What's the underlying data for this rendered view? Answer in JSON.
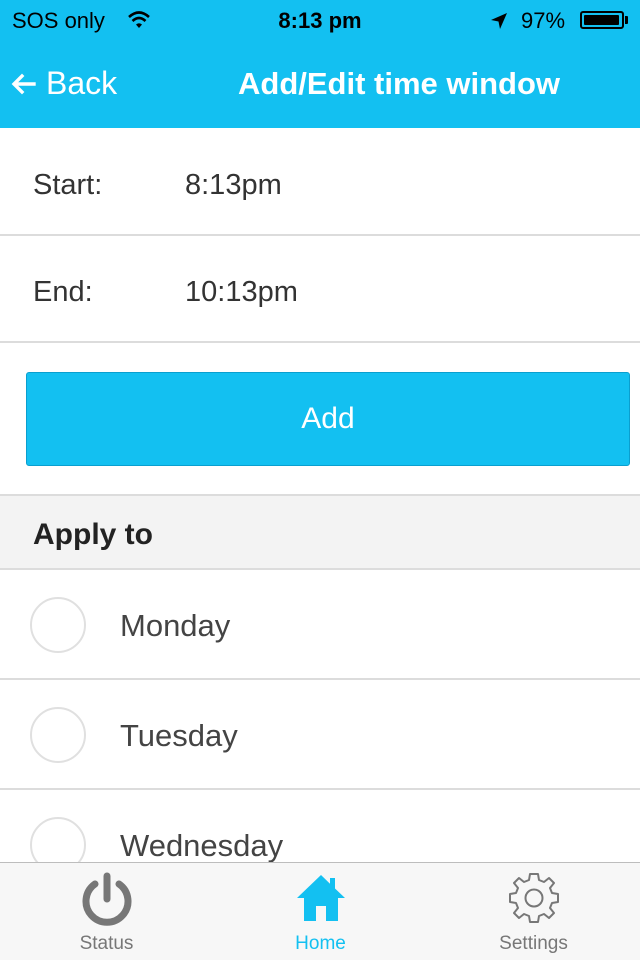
{
  "status_bar": {
    "carrier": "SOS only",
    "time": "8:13 pm",
    "battery_text": "97%",
    "battery_level": 0.97,
    "icons": [
      "wifi-icon",
      "location-arrow-icon",
      "battery-icon"
    ]
  },
  "nav": {
    "back_label": "Back",
    "title": "Add/Edit time window"
  },
  "time_window": {
    "start_label": "Start:",
    "start_value": "8:13pm",
    "end_label": "End:",
    "end_value": "10:13pm"
  },
  "add_button_label": "Add",
  "apply_section": {
    "title": "Apply to",
    "days": [
      {
        "label": "Monday",
        "selected": false
      },
      {
        "label": "Tuesday",
        "selected": false
      },
      {
        "label": "Wednesday",
        "selected": false
      }
    ]
  },
  "tabbar": {
    "tabs": [
      {
        "label": "Status",
        "icon": "power-icon",
        "active": false
      },
      {
        "label": "Home",
        "icon": "home-icon",
        "active": true
      },
      {
        "label": "Settings",
        "icon": "gear-icon",
        "active": false
      }
    ]
  },
  "colors": {
    "accent": "#13c0f1",
    "section_bg": "#f3f3f3",
    "divider": "#dcdcdc",
    "tab_inactive": "#777777"
  }
}
